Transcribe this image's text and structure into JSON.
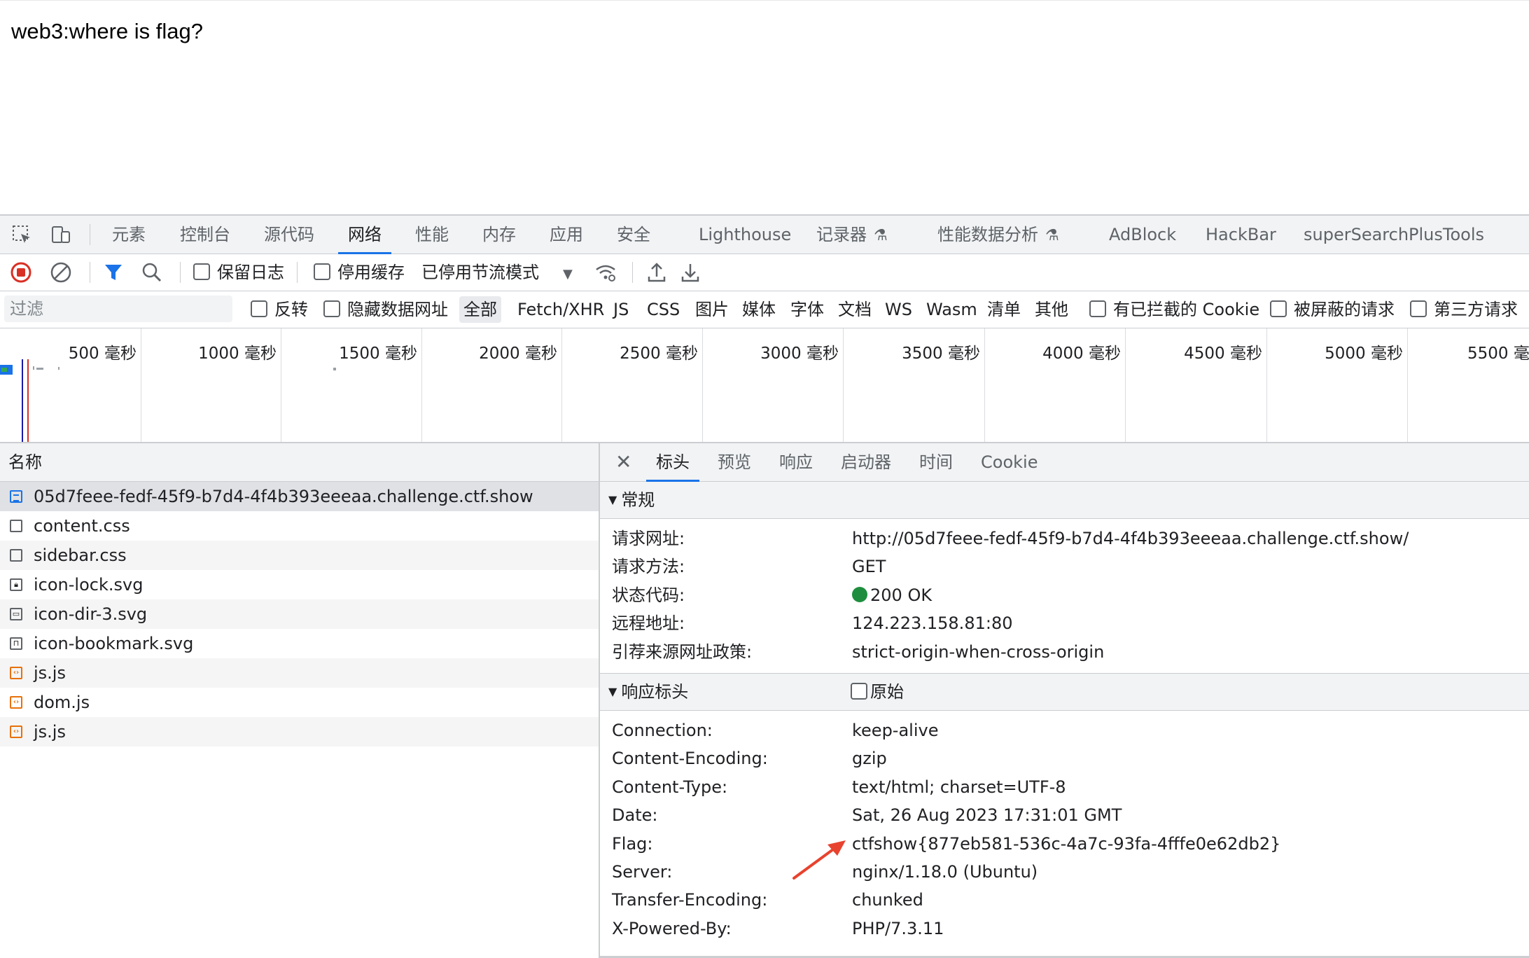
{
  "page": {
    "text": "web3:where is flag?"
  },
  "devtools": {
    "tabs": [
      "元素",
      "控制台",
      "源代码",
      "网络",
      "性能",
      "内存",
      "应用",
      "安全",
      "Lighthouse",
      "记录器",
      "性能数据分析",
      "AdBlock",
      "HackBar",
      "superSearchPlusTools"
    ],
    "active_tab": "网络",
    "experimental_icon": "beaker-icon"
  },
  "toolbar": {
    "preserve_log": "保留日志",
    "disable_cache": "停用缓存",
    "throttle": "已停用节流模式"
  },
  "filterbar": {
    "placeholder": "过滤",
    "invert": "反转",
    "hide_data_urls": "隐藏数据网址",
    "types": [
      "全部",
      "Fetch/XHR",
      "JS",
      "CSS",
      "图片",
      "媒体",
      "字体",
      "文档",
      "WS",
      "Wasm",
      "清单",
      "其他"
    ],
    "active_type": "全部",
    "blocked_cookies": "有已拦截的 Cookie",
    "blocked_requests": "被屏蔽的请求",
    "third_party": "第三方请求"
  },
  "overview": {
    "ticks": [
      "500 毫秒",
      "1000 毫秒",
      "1500 毫秒",
      "2000 毫秒",
      "2500 毫秒",
      "3000 毫秒",
      "3500 毫秒",
      "4000 毫秒",
      "4500 毫秒",
      "5000 毫秒",
      "5500 毫"
    ]
  },
  "requests": {
    "header": "名称",
    "items": [
      {
        "name": "05d7feee-fedf-45f9-b7d4-4f4b393eeeaa.challenge.ctf.show",
        "type": "doc",
        "icon": "document-icon"
      },
      {
        "name": "content.css",
        "type": "css",
        "icon": "stylesheet-icon"
      },
      {
        "name": "sidebar.css",
        "type": "css",
        "icon": "stylesheet-icon"
      },
      {
        "name": "icon-lock.svg",
        "type": "img",
        "icon": "lock-icon"
      },
      {
        "name": "icon-dir-3.svg",
        "type": "img",
        "icon": "folder-icon"
      },
      {
        "name": "icon-bookmark.svg",
        "type": "img",
        "icon": "bookmark-icon"
      },
      {
        "name": "js.js",
        "type": "js",
        "icon": "script-icon"
      },
      {
        "name": "dom.js",
        "type": "js",
        "icon": "script-icon"
      },
      {
        "name": "js.js",
        "type": "js",
        "icon": "script-icon"
      }
    ]
  },
  "details": {
    "tabs": [
      "标头",
      "预览",
      "响应",
      "启动器",
      "时间",
      "Cookie"
    ],
    "active_tab": "标头",
    "general": {
      "title": "常规",
      "rows": [
        {
          "k": "请求网址:",
          "v": "http://05d7feee-fedf-45f9-b7d4-4f4b393eeeaa.challenge.ctf.show/"
        },
        {
          "k": "请求方法:",
          "v": "GET"
        },
        {
          "k": "状态代码:",
          "v": "200 OK"
        },
        {
          "k": "远程地址:",
          "v": "124.223.158.81:80"
        },
        {
          "k": "引荐来源网址政策:",
          "v": "strict-origin-when-cross-origin"
        }
      ]
    },
    "response": {
      "title": "响应标头",
      "raw_label": "原始",
      "rows": [
        {
          "k": "Connection:",
          "v": "keep-alive"
        },
        {
          "k": "Content-Encoding:",
          "v": "gzip"
        },
        {
          "k": "Content-Type:",
          "v": "text/html; charset=UTF-8"
        },
        {
          "k": "Date:",
          "v": "Sat, 26 Aug 2023 17:31:01 GMT"
        },
        {
          "k": "Flag:",
          "v": "ctfshow{877eb581-536c-4a7c-93fa-4fffe0e62db2}"
        },
        {
          "k": "Server:",
          "v": "nginx/1.18.0 (Ubuntu)"
        },
        {
          "k": "Transfer-Encoding:",
          "v": "chunked"
        },
        {
          "k": "X-Powered-By:",
          "v": "PHP/7.3.11"
        }
      ]
    }
  },
  "colors": {
    "accent": "#1a73e8",
    "record": "#d93025",
    "status_ok": "#1e8e3e",
    "annotation": "#e8432e"
  }
}
